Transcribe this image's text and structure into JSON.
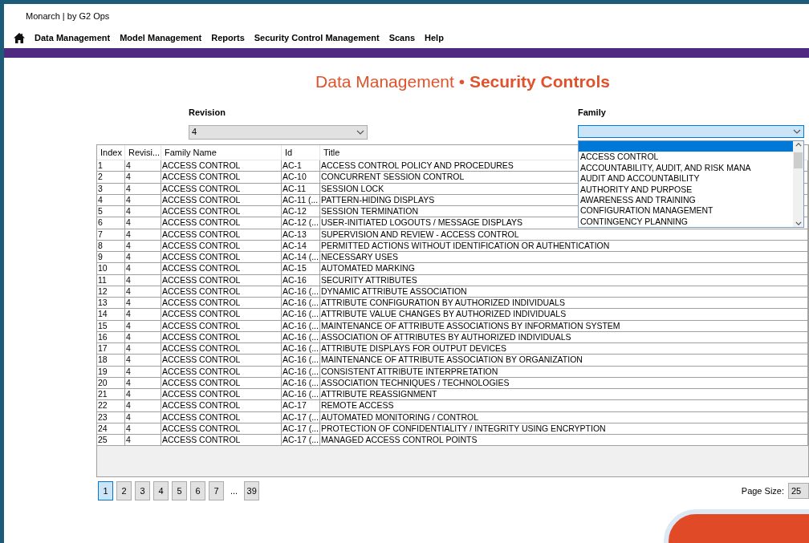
{
  "window": {
    "title": "Monarch | by G2 Ops"
  },
  "menu": [
    {
      "label": "Data Management"
    },
    {
      "label": "Model Management"
    },
    {
      "label": "Reports"
    },
    {
      "label": "Security Control Management"
    },
    {
      "label": "Scans"
    },
    {
      "label": "Help"
    }
  ],
  "heading": "Data Management • **Security Controls**",
  "revision": {
    "label": "Revision",
    "value": "4"
  },
  "family": {
    "label": "Family",
    "expanded": true,
    "options": [
      {
        "selected": true
      },
      {
        "label": "ACCESS CONTROL",
        "selected": false
      },
      {
        "label": "ACCOUNTABILITY, AUDIT, AND RISK MANA",
        "selected": false
      },
      {
        "label": "AUDIT AND ACCOUNTABILITY",
        "selected": false
      },
      {
        "label": "AUTHORITY AND PURPOSE",
        "selected": false
      },
      {
        "label": "AWARENESS AND TRAINING",
        "selected": false
      },
      {
        "label": "CONFIGURATION MANAGEMENT",
        "selected": false
      },
      {
        "label": "CONTINGENCY PLANNING",
        "selected": false
      }
    ]
  },
  "table": {
    "columns": [
      "Index",
      "Revisi...",
      "Family Name",
      "Id",
      "Title"
    ],
    "rows": [
      [
        "1",
        "4",
        "ACCESS CONTROL",
        "AC-1",
        "ACCESS CONTROL POLICY AND PROCEDURES"
      ],
      [
        "2",
        "4",
        "ACCESS CONTROL",
        "AC-10",
        "CONCURRENT SESSION CONTROL"
      ],
      [
        "3",
        "4",
        "ACCESS CONTROL",
        "AC-11",
        "SESSION LOCK"
      ],
      [
        "4",
        "4",
        "ACCESS CONTROL",
        "AC-11 (...",
        "PATTERN-HIDING DISPLAYS"
      ],
      [
        "5",
        "4",
        "ACCESS CONTROL",
        "AC-12",
        "SESSION TERMINATION"
      ],
      [
        "6",
        "4",
        "ACCESS CONTROL",
        "AC-12 (...",
        "USER-INITIATED LOGOUTS / MESSAGE DISPLAYS"
      ],
      [
        "7",
        "4",
        "ACCESS CONTROL",
        "AC-13",
        "SUPERVISION AND REVIEW - ACCESS CONTROL"
      ],
      [
        "8",
        "4",
        "ACCESS CONTROL",
        "AC-14",
        "PERMITTED ACTIONS WITHOUT IDENTIFICATION OR AUTHENTICATION"
      ],
      [
        "9",
        "4",
        "ACCESS CONTROL",
        "AC-14 (...",
        "NECESSARY USES"
      ],
      [
        "10",
        "4",
        "ACCESS CONTROL",
        "AC-15",
        "AUTOMATED MARKING"
      ],
      [
        "11",
        "4",
        "ACCESS CONTROL",
        "AC-16",
        "SECURITY ATTRIBUTES"
      ],
      [
        "12",
        "4",
        "ACCESS CONTROL",
        "AC-16 (...",
        "DYNAMIC ATTRIBUTE ASSOCIATION"
      ],
      [
        "13",
        "4",
        "ACCESS CONTROL",
        "AC-16 (...",
        "ATTRIBUTE CONFIGURATION BY AUTHORIZED INDIVIDUALS"
      ],
      [
        "14",
        "4",
        "ACCESS CONTROL",
        "AC-16 (...",
        "ATTRIBUTE VALUE CHANGES BY AUTHORIZED INDIVIDUALS"
      ],
      [
        "15",
        "4",
        "ACCESS CONTROL",
        "AC-16 (...",
        "MAINTENANCE OF ATTRIBUTE ASSOCIATIONS BY INFORMATION SYSTEM"
      ],
      [
        "16",
        "4",
        "ACCESS CONTROL",
        "AC-16 (...",
        "ASSOCIATION OF ATTRIBUTES BY AUTHORIZED INDIVIDUALS"
      ],
      [
        "17",
        "4",
        "ACCESS CONTROL",
        "AC-16 (...",
        "ATTRIBUTE DISPLAYS FOR OUTPUT DEVICES"
      ],
      [
        "18",
        "4",
        "ACCESS CONTROL",
        "AC-16 (...",
        "MAINTENANCE OF ATTRIBUTE ASSOCIATION BY ORGANIZATION"
      ],
      [
        "19",
        "4",
        "ACCESS CONTROL",
        "AC-16 (...",
        "CONSISTENT ATTRIBUTE INTERPRETATION"
      ],
      [
        "20",
        "4",
        "ACCESS CONTROL",
        "AC-16 (...",
        "ASSOCIATION TECHNIQUES / TECHNOLOGIES"
      ],
      [
        "21",
        "4",
        "ACCESS CONTROL",
        "AC-16 (...",
        "ATTRIBUTE REASSIGNMENT"
      ],
      [
        "22",
        "4",
        "ACCESS CONTROL",
        "AC-17",
        "REMOTE ACCESS"
      ],
      [
        "23",
        "4",
        "ACCESS CONTROL",
        "AC-17 (...",
        "AUTOMATED MONITORING / CONTROL"
      ],
      [
        "24",
        "4",
        "ACCESS CONTROL",
        "AC-17 (...",
        "PROTECTION OF CONFIDENTIALITY / INTEGRITY USING ENCRYPTION"
      ],
      [
        "25",
        "4",
        "ACCESS CONTROL",
        "AC-17 (...",
        "MANAGED ACCESS CONTROL POINTS"
      ]
    ]
  },
  "pagination": {
    "pages": [
      {
        "label": "1",
        "selected": true
      },
      {
        "label": "2",
        "selected": false
      },
      {
        "label": "3",
        "selected": false
      },
      {
        "label": "4",
        "selected": false
      },
      {
        "label": "5",
        "selected": false
      },
      {
        "label": "6",
        "selected": false
      },
      {
        "label": "7",
        "selected": false
      }
    ],
    "ellipsis": "...",
    "last": {
      "label": "39",
      "selected": false
    },
    "page_size_label": "Page Size:",
    "page_size": "25"
  }
}
